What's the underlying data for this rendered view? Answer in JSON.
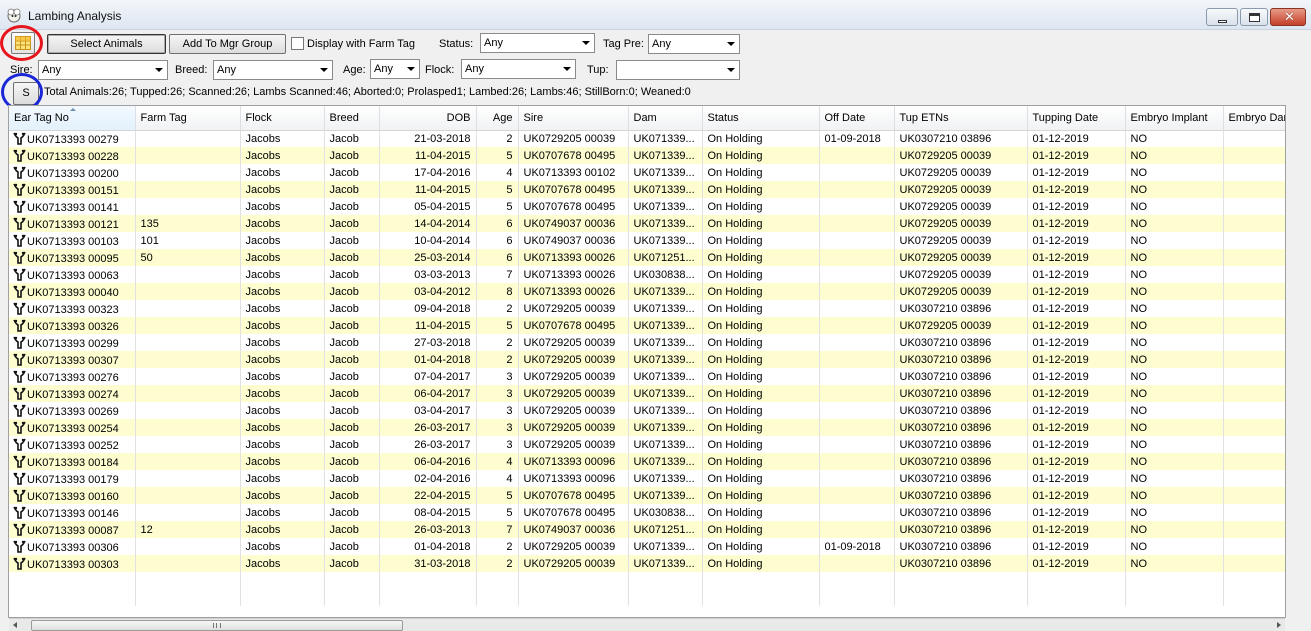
{
  "window": {
    "title": "Lambing Analysis"
  },
  "toolbar": {
    "select_animals": "Select Animals",
    "add_to_mgr_group": "Add To Mgr Group",
    "display_farm_tag": "Display with Farm Tag",
    "status_label": "Status:",
    "status_value": "Any",
    "tag_pre_label": "Tag Pre:",
    "tag_pre_value": "Any",
    "sire_label": "Sire:",
    "sire_value": "Any",
    "breed_label": "Breed:",
    "breed_value": "Any",
    "age_label": "Age:",
    "age_value": "Any",
    "flock_label": "Flock:",
    "flock_value": "Any",
    "tup_label": "Tup:",
    "tup_value": "",
    "s_button": "S"
  },
  "summary": "Total Animals:26; Tupped:26; Scanned:26; Lambs Scanned:46; Aborted:0; Prolasped1; Lambed:26; Lambs:46; StillBorn:0; Weaned:0",
  "annotation_colors": {
    "red_circle": "#e8141b",
    "blue_circle": "#1a27d6",
    "alt_row": "#fdfdd0"
  },
  "columns": [
    "Ear Tag No",
    "Farm Tag",
    "Flock",
    "Breed",
    "DOB",
    "Age",
    "Sire",
    "Dam",
    "Status",
    "Off Date",
    "Tup ETNs",
    "Tupping Date",
    "Embryo Implant",
    "Embryo Dar"
  ],
  "rows": [
    [
      "UK0713393 00279",
      "",
      "Jacobs",
      "Jacob",
      "21-03-2018",
      "2",
      "UK0729205 00039",
      "UK071339...",
      "On Holding",
      "01-09-2018",
      "UK0307210 03896",
      "01-12-2019",
      "NO",
      ""
    ],
    [
      "UK0713393 00228",
      "",
      "Jacobs",
      "Jacob",
      "11-04-2015",
      "5",
      "UK0707678 00495",
      "UK071339...",
      "On Holding",
      "",
      "UK0729205 00039",
      "01-12-2019",
      "NO",
      ""
    ],
    [
      "UK0713393 00200",
      "",
      "Jacobs",
      "Jacob",
      "17-04-2016",
      "4",
      "UK0713393 00102",
      "UK071339...",
      "On Holding",
      "",
      "UK0729205 00039",
      "01-12-2019",
      "NO",
      ""
    ],
    [
      "UK0713393 00151",
      "",
      "Jacobs",
      "Jacob",
      "11-04-2015",
      "5",
      "UK0707678 00495",
      "UK071339...",
      "On Holding",
      "",
      "UK0729205 00039",
      "01-12-2019",
      "NO",
      ""
    ],
    [
      "UK0713393 00141",
      "",
      "Jacobs",
      "Jacob",
      "05-04-2015",
      "5",
      "UK0707678 00495",
      "UK071339...",
      "On Holding",
      "",
      "UK0729205 00039",
      "01-12-2019",
      "NO",
      ""
    ],
    [
      "UK0713393 00121",
      "135",
      "Jacobs",
      "Jacob",
      "14-04-2014",
      "6",
      "UK0749037 00036",
      "UK071339...",
      "On Holding",
      "",
      "UK0729205 00039",
      "01-12-2019",
      "NO",
      ""
    ],
    [
      "UK0713393 00103",
      "101",
      "Jacobs",
      "Jacob",
      "10-04-2014",
      "6",
      "UK0749037 00036",
      "UK071339...",
      "On Holding",
      "",
      "UK0729205 00039",
      "01-12-2019",
      "NO",
      ""
    ],
    [
      "UK0713393 00095",
      "50",
      "Jacobs",
      "Jacob",
      "25-03-2014",
      "6",
      "UK0713393 00026",
      "UK071251...",
      "On Holding",
      "",
      "UK0729205 00039",
      "01-12-2019",
      "NO",
      ""
    ],
    [
      "UK0713393 00063",
      "",
      "Jacobs",
      "Jacob",
      "03-03-2013",
      "7",
      "UK0713393 00026",
      "UK030838...",
      "On Holding",
      "",
      "UK0729205 00039",
      "01-12-2019",
      "NO",
      ""
    ],
    [
      "UK0713393 00040",
      "",
      "Jacobs",
      "Jacob",
      "03-04-2012",
      "8",
      "UK0713393 00026",
      "UK071339...",
      "On Holding",
      "",
      "UK0729205 00039",
      "01-12-2019",
      "NO",
      ""
    ],
    [
      "UK0713393 00323",
      "",
      "Jacobs",
      "Jacob",
      "09-04-2018",
      "2",
      "UK0729205 00039",
      "UK071339...",
      "On Holding",
      "",
      "UK0307210 03896",
      "01-12-2019",
      "NO",
      ""
    ],
    [
      "UK0713393 00326",
      "",
      "Jacobs",
      "Jacob",
      "11-04-2015",
      "5",
      "UK0707678 00495",
      "UK071339...",
      "On Holding",
      "",
      "UK0729205 00039",
      "01-12-2019",
      "NO",
      ""
    ],
    [
      "UK0713393 00299",
      "",
      "Jacobs",
      "Jacob",
      "27-03-2018",
      "2",
      "UK0729205 00039",
      "UK071339...",
      "On Holding",
      "",
      "UK0307210 03896",
      "01-12-2019",
      "NO",
      ""
    ],
    [
      "UK0713393 00307",
      "",
      "Jacobs",
      "Jacob",
      "01-04-2018",
      "2",
      "UK0729205 00039",
      "UK071339...",
      "On Holding",
      "",
      "UK0307210 03896",
      "01-12-2019",
      "NO",
      ""
    ],
    [
      "UK0713393 00276",
      "",
      "Jacobs",
      "Jacob",
      "07-04-2017",
      "3",
      "UK0729205 00039",
      "UK071339...",
      "On Holding",
      "",
      "UK0307210 03896",
      "01-12-2019",
      "NO",
      ""
    ],
    [
      "UK0713393 00274",
      "",
      "Jacobs",
      "Jacob",
      "06-04-2017",
      "3",
      "UK0729205 00039",
      "UK071339...",
      "On Holding",
      "",
      "UK0307210 03896",
      "01-12-2019",
      "NO",
      ""
    ],
    [
      "UK0713393 00269",
      "",
      "Jacobs",
      "Jacob",
      "03-04-2017",
      "3",
      "UK0729205 00039",
      "UK071339...",
      "On Holding",
      "",
      "UK0307210 03896",
      "01-12-2019",
      "NO",
      ""
    ],
    [
      "UK0713393 00254",
      "",
      "Jacobs",
      "Jacob",
      "26-03-2017",
      "3",
      "UK0729205 00039",
      "UK071339...",
      "On Holding",
      "",
      "UK0307210 03896",
      "01-12-2019",
      "NO",
      ""
    ],
    [
      "UK0713393 00252",
      "",
      "Jacobs",
      "Jacob",
      "26-03-2017",
      "3",
      "UK0729205 00039",
      "UK071339...",
      "On Holding",
      "",
      "UK0307210 03896",
      "01-12-2019",
      "NO",
      ""
    ],
    [
      "UK0713393 00184",
      "",
      "Jacobs",
      "Jacob",
      "06-04-2016",
      "4",
      "UK0713393 00096",
      "UK071339...",
      "On Holding",
      "",
      "UK0307210 03896",
      "01-12-2019",
      "NO",
      ""
    ],
    [
      "UK0713393 00179",
      "",
      "Jacobs",
      "Jacob",
      "02-04-2016",
      "4",
      "UK0713393 00096",
      "UK071339...",
      "On Holding",
      "",
      "UK0307210 03896",
      "01-12-2019",
      "NO",
      ""
    ],
    [
      "UK0713393 00160",
      "",
      "Jacobs",
      "Jacob",
      "22-04-2015",
      "5",
      "UK0707678 00495",
      "UK071339...",
      "On Holding",
      "",
      "UK0307210 03896",
      "01-12-2019",
      "NO",
      ""
    ],
    [
      "UK0713393 00146",
      "",
      "Jacobs",
      "Jacob",
      "08-04-2015",
      "5",
      "UK0707678 00495",
      "UK030838...",
      "On Holding",
      "",
      "UK0307210 03896",
      "01-12-2019",
      "NO",
      ""
    ],
    [
      "UK0713393 00087",
      "12",
      "Jacobs",
      "Jacob",
      "26-03-2013",
      "7",
      "UK0749037 00036",
      "UK071251...",
      "On Holding",
      "",
      "UK0307210 03896",
      "01-12-2019",
      "NO",
      ""
    ],
    [
      "UK0713393 00306",
      "",
      "Jacobs",
      "Jacob",
      "01-04-2018",
      "2",
      "UK0729205 00039",
      "UK071339...",
      "On Holding",
      "01-09-2018",
      "UK0307210 03896",
      "01-12-2019",
      "NO",
      ""
    ],
    [
      "UK0713393 00303",
      "",
      "Jacobs",
      "Jacob",
      "31-03-2018",
      "2",
      "UK0729205 00039",
      "UK071339...",
      "On Holding",
      "",
      "UK0307210 03896",
      "01-12-2019",
      "NO",
      ""
    ]
  ],
  "icons": {
    "row_icon": "sheep-tag-icon",
    "app_icon": "sheep-icon"
  }
}
